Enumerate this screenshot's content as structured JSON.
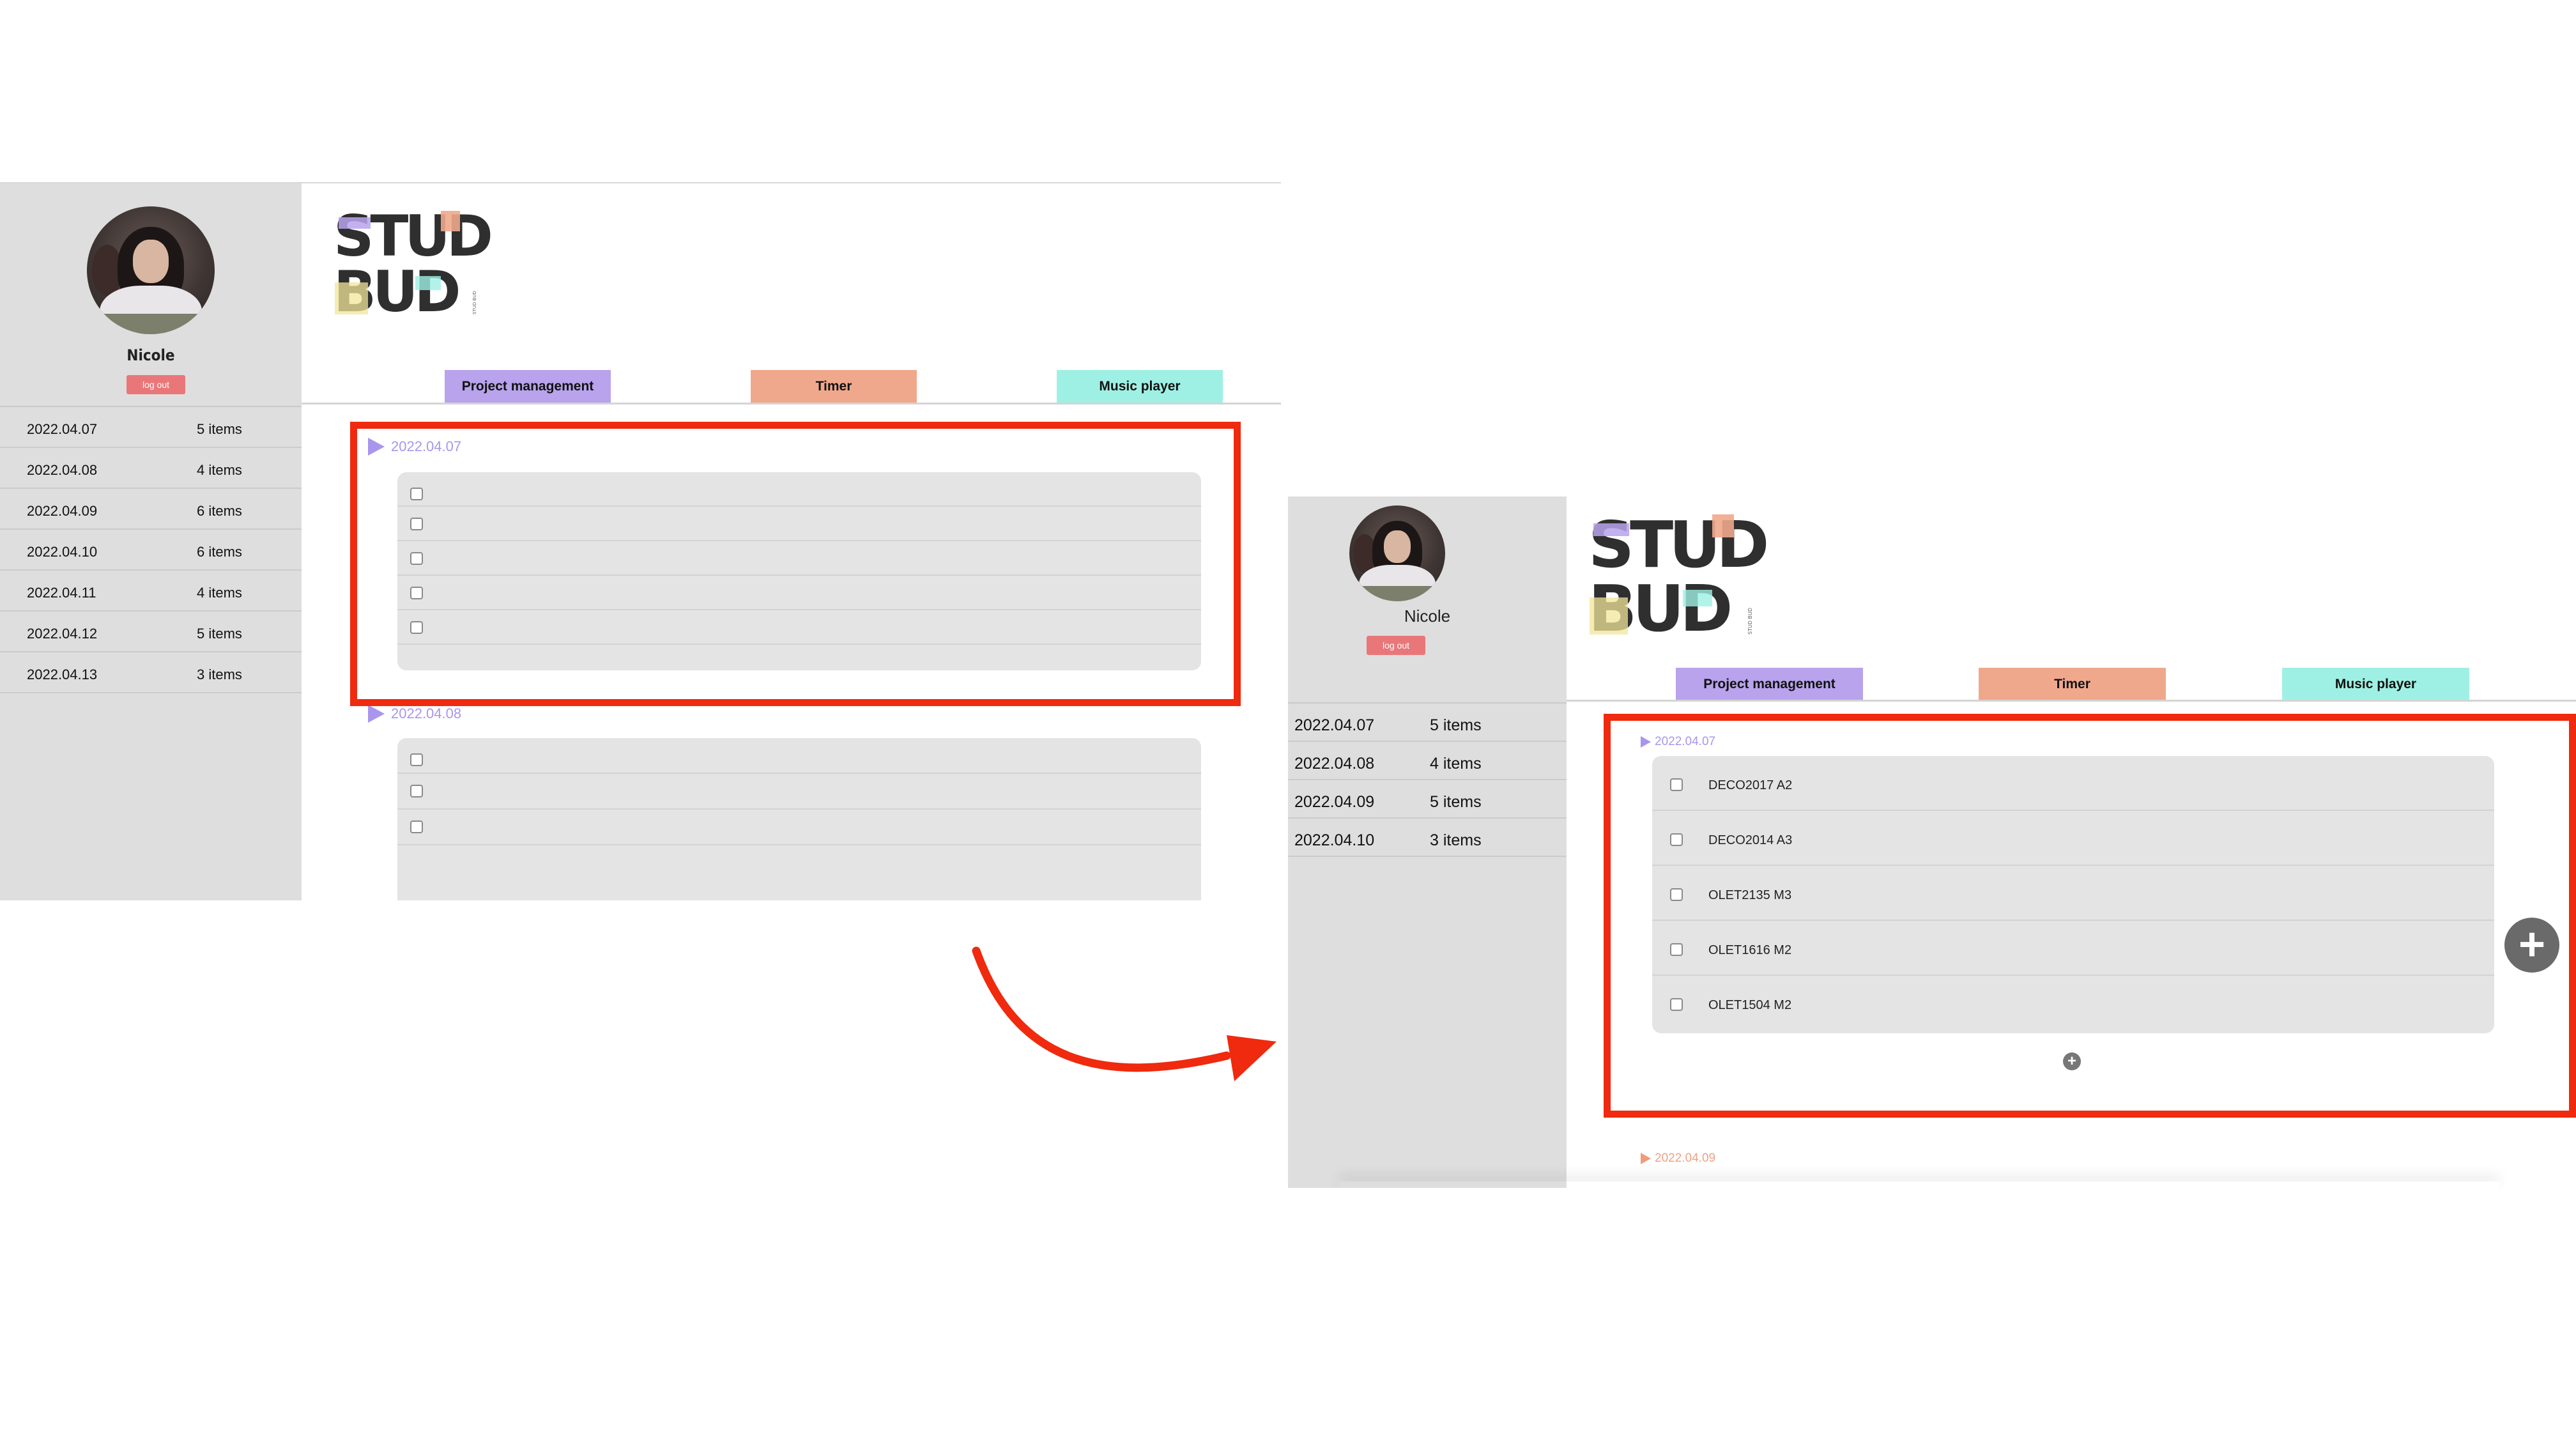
{
  "app": {
    "logo_text": "STUD BUD"
  },
  "user": {
    "name": "Nicole",
    "logout_label": "log out"
  },
  "tabs": {
    "project": "Project management",
    "timer": "Timer",
    "music": "Music player"
  },
  "before": {
    "dates": [
      {
        "date": "2022.04.07",
        "count": "5 items"
      },
      {
        "date": "2022.04.08",
        "count": "4 items"
      },
      {
        "date": "2022.04.09",
        "count": "6 items"
      },
      {
        "date": "2022.04.10",
        "count": "6 items"
      },
      {
        "date": "2022.04.11",
        "count": "4 items"
      },
      {
        "date": "2022.04.12",
        "count": "5 items"
      },
      {
        "date": "2022.04.13",
        "count": "3 items"
      }
    ],
    "groups": [
      {
        "date": "2022.04.07"
      },
      {
        "date": "2022.04.08"
      }
    ]
  },
  "after": {
    "dates": [
      {
        "date": "2022.04.07",
        "count": "5   items"
      },
      {
        "date": "2022.04.08",
        "count": "4   items"
      },
      {
        "date": "2022.04.09",
        "count": "5   items"
      },
      {
        "date": "2022.04.10",
        "count": "3   items"
      }
    ],
    "groups": [
      {
        "date": "2022.04.07",
        "tasks": [
          "DECO2017 A2",
          "DECO2014 A3",
          "OLET2135 M3",
          "OLET1616 M2",
          "OLET1504 M2"
        ]
      },
      {
        "date": "2022.04.09"
      }
    ]
  },
  "colors": {
    "highlight": "#ef2a0e",
    "project_tab": "#b8a3ec",
    "timer_tab": "#f0a88c",
    "music_tab": "#9ff0e4",
    "logout": "#e9777a"
  },
  "icons": [
    "plus-circle-icon",
    "triangle-right-icon",
    "checkbox-icon",
    "curved-arrow-icon"
  ]
}
